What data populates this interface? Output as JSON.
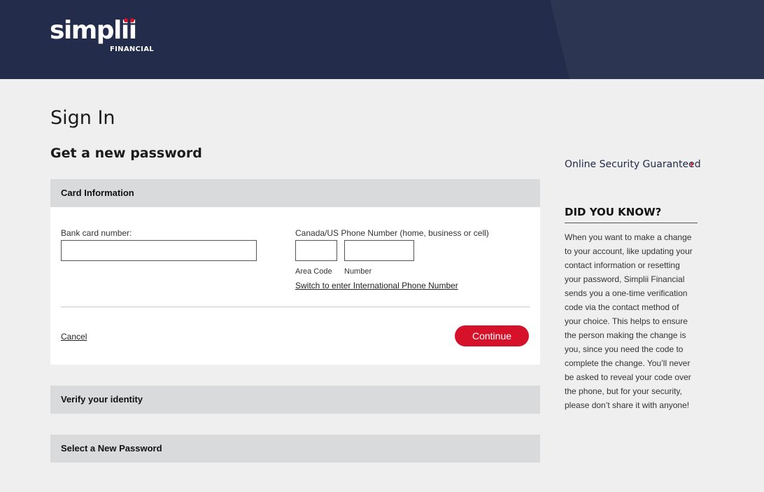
{
  "header": {
    "logo_text": "simplii",
    "logo_subtext": "FINANCIAL"
  },
  "page": {
    "title": "Sign In",
    "subtitle": "Get a new password"
  },
  "card_information": {
    "header": "Card Information",
    "bank_card_label": "Bank card number:",
    "bank_card_value": "",
    "phone_label": "Canada/US Phone Number (home, business or cell)",
    "area_code_value": "",
    "number_value": "",
    "area_code_label": "Area Code",
    "number_label": "Number",
    "intl_link": "Switch to enter International Phone Number",
    "cancel_label": "Cancel",
    "continue_label": "Continue"
  },
  "steps": [
    {
      "label": "Verify your identity"
    },
    {
      "label": "Select a New Password"
    }
  ],
  "sidebar": {
    "security_link": "Online Security Guaranteed",
    "chevron": "›",
    "dyk_title": "DID YOU KNOW?",
    "dyk_lines": [
      "When you want to make a change",
      "to your account, like updating your",
      "contact information or resetting",
      "your password, Simplii Financial",
      "sends you a one-time verification",
      "code via the contact method of",
      "your choice. This helps to ensure",
      "the person making the change is",
      "you, since you need the code to",
      "complete the change. You’ll never",
      "be asked to reveal your code over",
      "the phone, but for your security,",
      "please don’t share it with anyone!"
    ]
  },
  "colors": {
    "header_bg": "#232c4b",
    "brand_red": "#d6122b",
    "page_bg": "#efefef",
    "section_bg": "#d9dadb"
  }
}
